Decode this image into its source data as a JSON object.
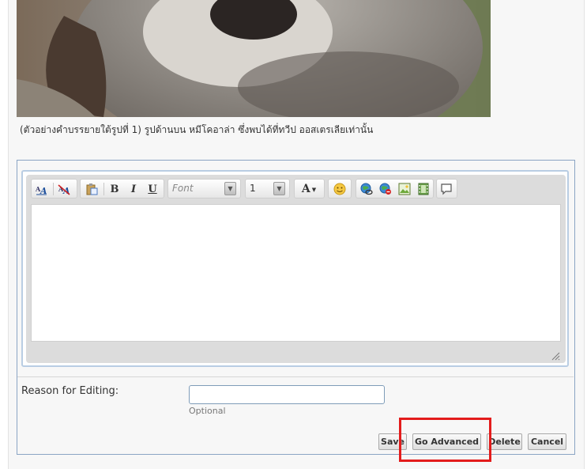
{
  "caption": "(ตัวอย่างคำบรรยายใต้รูปที่ 1) รูปด้านบน หมีโคอาล่า ซึ่งพบได้ที่ทวีป ออสเตรเลียเท่านั้น",
  "toolbar": {
    "font_placeholder": "Font",
    "size_value": "1"
  },
  "reason": {
    "label": "Reason for Editing:",
    "value": "",
    "note": "Optional"
  },
  "buttons": {
    "save": "Save",
    "go_advanced": "Go Advanced",
    "delete": "Delete",
    "cancel": "Cancel"
  },
  "colors": {
    "highlight": "#e31c1c",
    "editor_border": "#b9cde3"
  },
  "icons": [
    "remove-text-formatting-icon",
    "remove-formatting-icon",
    "paste-icon",
    "bold-icon",
    "italic-icon",
    "underline-icon",
    "text-color-icon",
    "smiley-icon",
    "link-icon",
    "unlink-icon",
    "image-icon",
    "video-icon",
    "quote-icon",
    "resize-grip-icon"
  ]
}
